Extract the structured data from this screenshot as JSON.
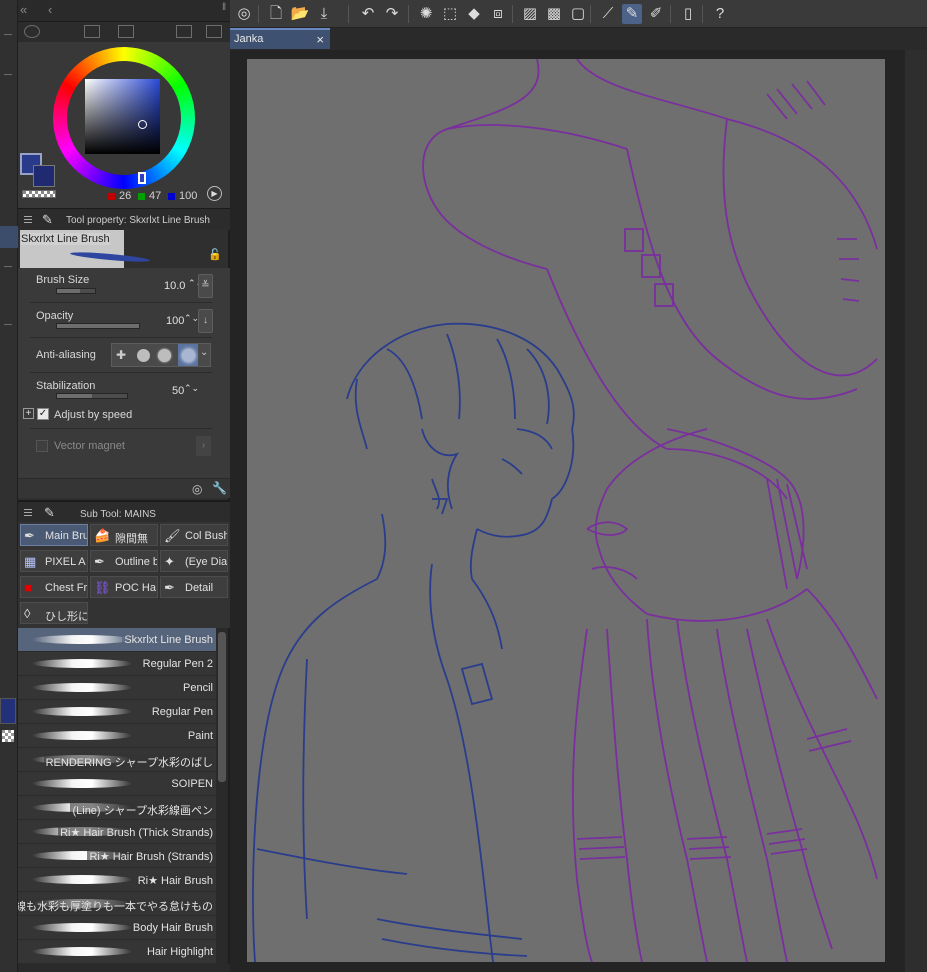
{
  "color": {
    "main_hex": "#2a3a8a",
    "sub_hex": "#202a70",
    "r": "26",
    "g": "47",
    "b": "100"
  },
  "tool_property": {
    "header": "Tool property: Skxrlxt Line Brush",
    "brush_name": "Skxrlxt Line Brush",
    "brush_size_label": "Brush Size",
    "brush_size_value": "10.0",
    "brush_size_level": 0.6,
    "opacity_label": "Opacity",
    "opacity_value": "100",
    "opacity_level": 1.0,
    "antialiasing_label": "Anti-aliasing",
    "stabilization_label": "Stabilization",
    "stabilization_value": "50",
    "stabilization_level": 0.5,
    "adjust_by_speed_label": "Adjust by speed",
    "adjust_by_speed_checked": true,
    "vector_magnet_label": "Vector magnet"
  },
  "sub_tool": {
    "header": "Sub Tool: MAINS",
    "groups": [
      {
        "label": "Main Bru",
        "icon": "pen-icon",
        "active": true
      },
      {
        "label": "隙間無",
        "icon": "cake-icon",
        "active": false
      },
      {
        "label": "Col Bush",
        "icon": "brush-icon",
        "active": false
      },
      {
        "label": "PIXEL A",
        "icon": "pixel-icon",
        "active": false
      },
      {
        "label": "Outline b",
        "icon": "pen-icon",
        "active": false
      },
      {
        "label": "(Eye Dia",
        "icon": "sparkle-icon",
        "active": false
      },
      {
        "label": "Chest Fr",
        "icon": "red-square-icon",
        "active": false
      },
      {
        "label": "POC Ha",
        "icon": "chain-icon",
        "active": false
      },
      {
        "label": "Detail",
        "icon": "pen-icon",
        "active": false
      },
      {
        "label": "ひし形に",
        "icon": "diamond-icon",
        "active": false
      }
    ],
    "brushes": [
      {
        "name": "Skxrlxt Line Brush",
        "active": true
      },
      {
        "name": "Regular Pen 2",
        "active": false
      },
      {
        "name": "Pencil",
        "active": false
      },
      {
        "name": "Regular Pen",
        "active": false
      },
      {
        "name": "Paint",
        "active": false
      },
      {
        "name": "RENDERING シャープ水彩のばし",
        "active": false
      },
      {
        "name": "SOIPEN",
        "active": false
      },
      {
        "name": "(Line) シャープ水彩線画ペン",
        "active": false
      },
      {
        "name": "Ri★ Hair Brush (Thick Strands)",
        "active": false
      },
      {
        "name": "Ri★ Hair Brush (Strands)",
        "active": false
      },
      {
        "name": "Ri★ Hair Brush",
        "active": false
      },
      {
        "name": "主線も水彩も厚塗りも一本でやる怠けもの",
        "active": false
      },
      {
        "name": "Body Hair Brush",
        "active": false
      },
      {
        "name": "Hair Highlight",
        "active": false
      }
    ]
  },
  "document": {
    "tab_title": "Janka",
    "close_glyph": "×"
  },
  "toolbar_icons": [
    "companion-icon",
    "new-file-icon",
    "open-file-icon",
    "save-icon",
    "undo-icon",
    "redo-icon",
    "loading-icon",
    "clear-icon",
    "fill-icon",
    "transform-icon",
    "deselect-icon",
    "invert-selection-icon",
    "border-icon",
    "ruler-icon",
    "brush-active-icon",
    "pen-icon",
    "smartphone-icon",
    "help-icon"
  ]
}
